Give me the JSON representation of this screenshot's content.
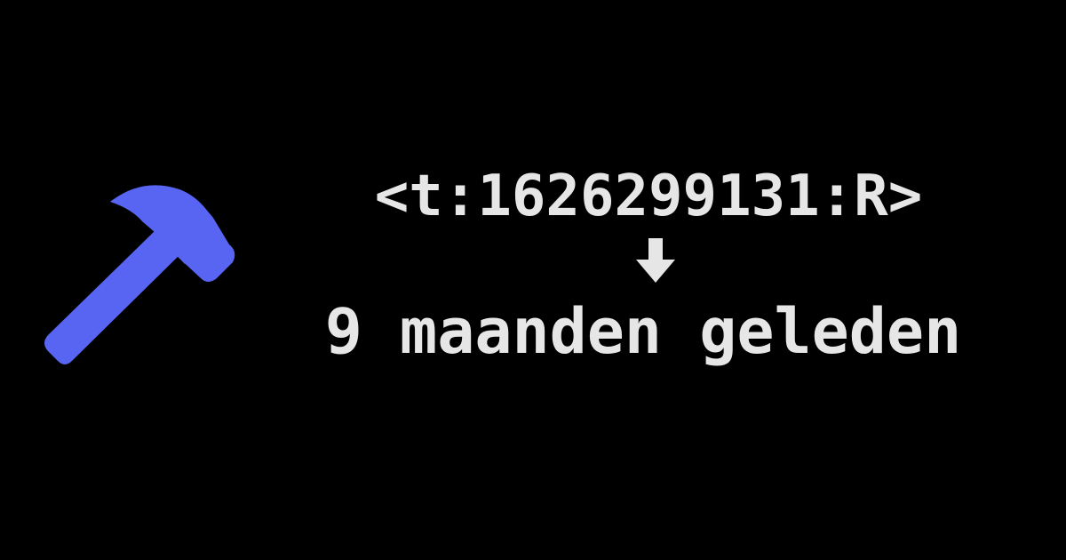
{
  "timestamp_tag": "<t:1626299131:R>",
  "result": "9 maanden geleden",
  "icons": {
    "left": "hammer-icon",
    "middle": "down-arrow-icon"
  },
  "colors": {
    "background": "#000000",
    "text": "#e6e6e6",
    "hammer": "#5865f2"
  }
}
